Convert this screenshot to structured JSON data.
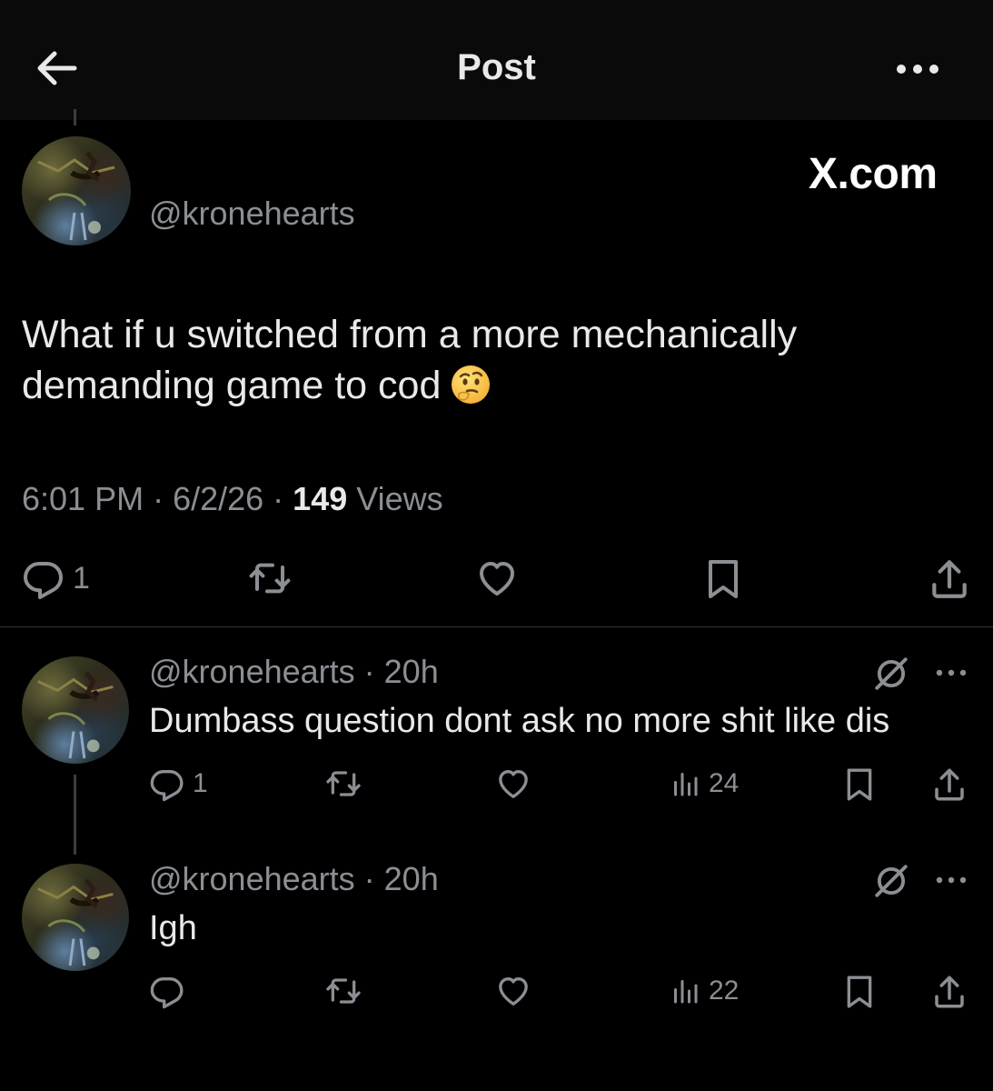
{
  "header": {
    "title": "Post"
  },
  "main_post": {
    "handle": "@kronehearts",
    "brand": "X.com",
    "text": "What if u switched from a more mechanically demanding game to cod",
    "emoji": "🤔",
    "time": "6:01 PM",
    "date": "6/2/26",
    "views_count": "149",
    "views_label": "Views",
    "reply_count": "1"
  },
  "replies": [
    {
      "handle": "@kronehearts",
      "age": "20h",
      "text": "Dumbass question dont ask no more shit like dis",
      "reply_count": "1",
      "views": "24"
    },
    {
      "handle": "@kronehearts",
      "age": "20h",
      "text": "Igh",
      "views": "22"
    }
  ],
  "colors": {
    "background": "#000000",
    "header_bg": "#0a0a0a",
    "text_primary": "#e7e9ea",
    "text_secondary": "#8b8f94",
    "divider": "#2f3336"
  },
  "icons": [
    "back-arrow-icon",
    "more-icon",
    "reply-icon",
    "repost-icon",
    "like-icon",
    "bookmark-icon",
    "share-icon",
    "views-icon",
    "grok-icon"
  ]
}
